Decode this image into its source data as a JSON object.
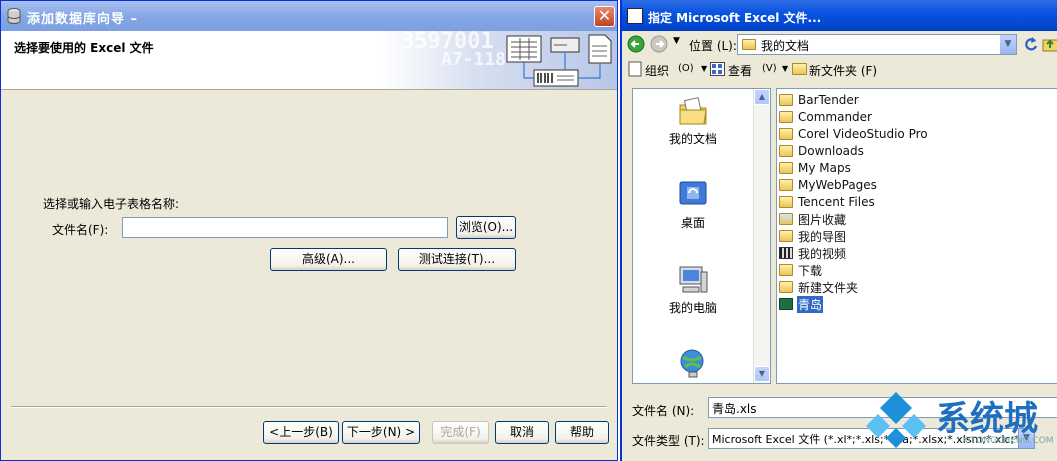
{
  "wizard": {
    "title": "添加数据库向导  –",
    "close": "✕",
    "header_title": "选择要使用的 Excel 文件",
    "banner_text1": "3597001",
    "banner_text2": "A7-118",
    "prompt": "选择或输入电子表格名称:",
    "file_label": "文件名(F):",
    "file_value": "",
    "browse": "浏览(O)...",
    "advanced": "高级(A)...",
    "test_connection": "测试连接(T)...",
    "back": "<上一步(B)",
    "next": "下一步(N) >",
    "finish": "完成(F)",
    "cancel": "取消",
    "help": "帮助"
  },
  "dialog": {
    "title": "指定 Microsoft Excel 文件...",
    "location_label": "位置 (L):",
    "location_value": "我的文档",
    "organize": "组织",
    "organize_key": "(O)",
    "view": "查看",
    "view_key": "(V)",
    "new_folder": "新文件夹 (F)",
    "places": [
      {
        "label": "我的文档",
        "icon": "my-documents-icon"
      },
      {
        "label": "桌面",
        "icon": "desktop-icon"
      },
      {
        "label": "我的电脑",
        "icon": "my-computer-icon"
      },
      {
        "label": "",
        "icon": "network-icon"
      }
    ],
    "files": [
      {
        "name": "BarTender",
        "type": "folder"
      },
      {
        "name": "Commander",
        "type": "folder"
      },
      {
        "name": "Corel VideoStudio Pro",
        "type": "folder"
      },
      {
        "name": "Downloads",
        "type": "folder"
      },
      {
        "name": "My Maps",
        "type": "folder"
      },
      {
        "name": "MyWebPages",
        "type": "folder"
      },
      {
        "name": "Tencent Files",
        "type": "folder"
      },
      {
        "name": "图片收藏",
        "type": "pictures"
      },
      {
        "name": "我的导图",
        "type": "folder"
      },
      {
        "name": "我的视频",
        "type": "video"
      },
      {
        "name": "下载",
        "type": "folder"
      },
      {
        "name": "新建文件夹",
        "type": "folder"
      },
      {
        "name": "青岛",
        "type": "excel",
        "selected": true
      }
    ],
    "filename_label": "文件名 (N):",
    "filename_value": "青岛.xls",
    "filetype_label": "文件类型 (T):",
    "filetype_value": "Microsoft Excel 文件 (*.xl*;*.xls;*.xla;*.xlsx;*.xlsm;*.xlc;*.xlw)"
  },
  "watermark": {
    "text": "系统城",
    "url": "XITONGCHENG.COM"
  }
}
